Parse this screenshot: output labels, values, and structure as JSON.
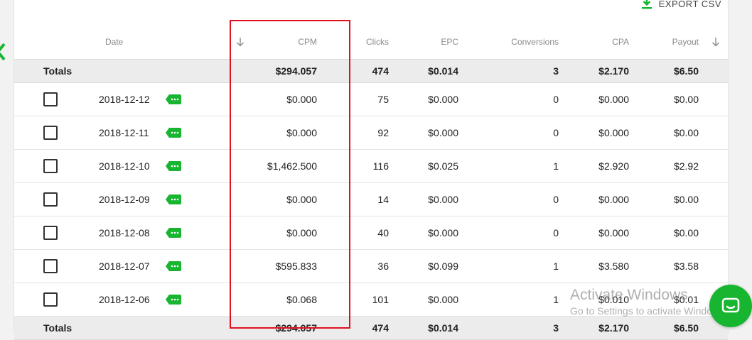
{
  "colors": {
    "accent_green": "#18b530",
    "highlight_red": "#e01020",
    "totals_bg": "#ececec"
  },
  "toolbar": {
    "export_label": "EXPORT CSV",
    "export_icon": "download-icon"
  },
  "table": {
    "columns": {
      "date": "Date",
      "cpm": "CPM",
      "clicks": "Clicks",
      "epc": "EPC",
      "conversions": "Conversions",
      "cpa": "CPA",
      "payout": "Payout"
    },
    "totals_top": {
      "label": "Totals",
      "cpm": "$294.057",
      "clicks": "474",
      "epc": "$0.014",
      "conversions": "3",
      "cpa": "$2.170",
      "payout": "$6.50"
    },
    "rows": [
      {
        "date": "2018-12-12",
        "cpm": "$0.000",
        "clicks": "75",
        "epc": "$0.000",
        "conversions": "0",
        "cpa": "$0.000",
        "payout": "$0.00"
      },
      {
        "date": "2018-12-11",
        "cpm": "$0.000",
        "clicks": "92",
        "epc": "$0.000",
        "conversions": "0",
        "cpa": "$0.000",
        "payout": "$0.00"
      },
      {
        "date": "2018-12-10",
        "cpm": "$1,462.500",
        "clicks": "116",
        "epc": "$0.025",
        "conversions": "1",
        "cpa": "$2.920",
        "payout": "$2.92"
      },
      {
        "date": "2018-12-09",
        "cpm": "$0.000",
        "clicks": "14",
        "epc": "$0.000",
        "conversions": "0",
        "cpa": "$0.000",
        "payout": "$0.00"
      },
      {
        "date": "2018-12-08",
        "cpm": "$0.000",
        "clicks": "40",
        "epc": "$0.000",
        "conversions": "0",
        "cpa": "$0.000",
        "payout": "$0.00"
      },
      {
        "date": "2018-12-07",
        "cpm": "$595.833",
        "clicks": "36",
        "epc": "$0.099",
        "conversions": "1",
        "cpa": "$3.580",
        "payout": "$3.58"
      },
      {
        "date": "2018-12-06",
        "cpm": "$0.068",
        "clicks": "101",
        "epc": "$0.000",
        "conversions": "1",
        "cpa": "$0.010",
        "payout": "$0.01"
      }
    ],
    "totals_bottom": {
      "label": "Totals",
      "cpm": "$294.057",
      "clicks": "474",
      "epc": "$0.014",
      "conversions": "3",
      "cpa": "$2.170",
      "payout": "$6.50"
    }
  },
  "watermark": {
    "line1": "Activate Windows",
    "line2": "Go to Settings to activate Windows."
  }
}
